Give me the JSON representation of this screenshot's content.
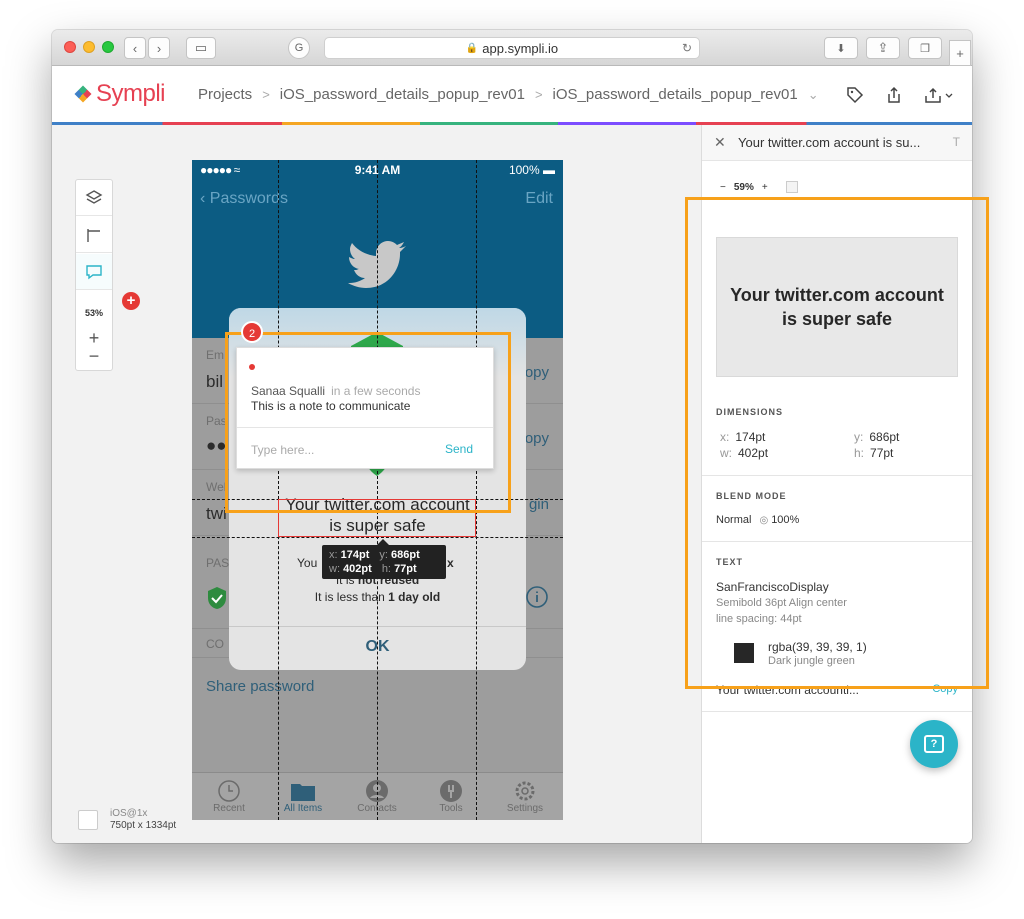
{
  "browser": {
    "url": "app.sympli.io"
  },
  "app": {
    "logo": "Sympli",
    "breadcrumbs": [
      "Projects",
      "iOS_password_details_popup_rev01",
      "iOS_password_details_popup_rev01"
    ]
  },
  "canvas": {
    "zoom": "53%",
    "device_label": "iOS@1x",
    "device_size": "750pt x 1334pt"
  },
  "phone": {
    "status_time": "9:41 AM",
    "status_battery": "100%",
    "nav_back": "Passwords",
    "nav_edit": "Edit",
    "rows": [
      {
        "label": "Em",
        "value": "bil",
        "action": "opy"
      },
      {
        "label": "Pas",
        "value": "●●",
        "action": "opy"
      },
      {
        "label": "Wel",
        "value": "twi",
        "action": "gin"
      }
    ],
    "section_pas": "PAS",
    "section_co": "CO",
    "share": "Share password",
    "tabs": [
      "Recent",
      "All Items",
      "Contacts",
      "Tools",
      "Settings"
    ]
  },
  "alert": {
    "title_line1": "Your twitter.com account",
    "title_line2": "is super safe",
    "line1_left": "You",
    "line1_right": "x",
    "line2_prefix": "It is ",
    "line2_bold": "not reused",
    "line3_prefix": "It is less than ",
    "line3_bold": "1 day old",
    "ok": "OK"
  },
  "measure": {
    "x": "174pt",
    "y": "686pt",
    "w": "402pt",
    "h": "77pt"
  },
  "comment": {
    "badge": "2",
    "author": "Sanaa Squalli",
    "time": "in a few seconds",
    "message": "This is a note to communicate",
    "placeholder": "Type here...",
    "send": "Send"
  },
  "panel": {
    "title": "Your twitter.com account is su...",
    "title_icon": "T",
    "zoom": "59%",
    "preview_text": "Your twitter.com account is super safe",
    "dimensions_title": "DIMENSIONS",
    "dims": {
      "x": "174pt",
      "y": "686pt",
      "w": "402pt",
      "h": "77pt"
    },
    "blend_title": "BLEND MODE",
    "blend_mode": "Normal",
    "opacity": "100%",
    "text_title": "TEXT",
    "font_family": "SanFranciscoDisplay",
    "font_style": "Semibold 36pt Align center",
    "line_spacing": "line spacing: 44pt",
    "color_value": "rgba(39, 39, 39, 1)",
    "color_name": "Dark jungle green",
    "text_value": "Your twitter.com accounti...",
    "copy": "Copy"
  }
}
